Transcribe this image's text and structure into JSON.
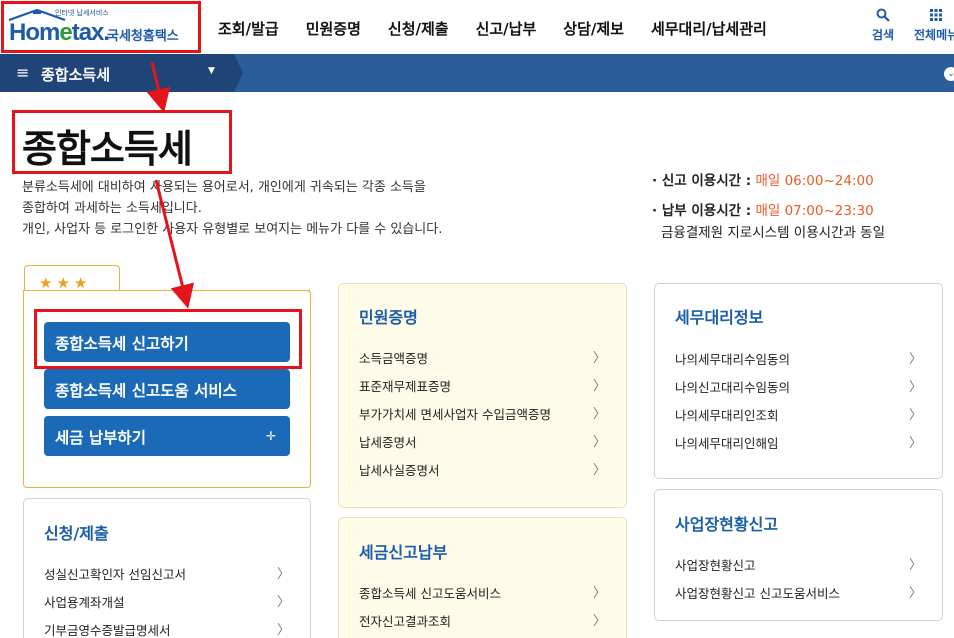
{
  "header": {
    "logo_small": "인터넷 납세서비스",
    "logo_brand_a": "Hom",
    "logo_brand_e": "e",
    "logo_brand_b": "tax.",
    "logo_sub": "국세청홈택스",
    "nav": [
      "조회/발급",
      "민원증명",
      "신청/제출",
      "신고/납부",
      "상담/제보",
      "세무대리/납세관리"
    ],
    "search_label": "검색",
    "allmenu_label": "전체메뉴"
  },
  "subbar": {
    "label": "종합소득세"
  },
  "page_title": "종합소득세",
  "description": [
    "분류소득세에 대비하여 사용되는 용어로서, 개인에게 귀속되는 각종 소득을",
    "종합하여 과세하는 소득세입니다.",
    "개인, 사업자 등 로그인한 사용자 유형별로 보여지는 메뉴가 다를 수 있습니다."
  ],
  "info": {
    "report_key": "· 신고 이용시간 :",
    "report_val": "매일 06:00~24:00",
    "pay_key": "· 납부 이용시간 :",
    "pay_val": "매일 07:00~23:30",
    "pay_note": "금융결제원 지로시스템 이용시간과 동일"
  },
  "quick": {
    "stars": "★★★",
    "buttons": [
      "종합소득세 신고하기",
      "종합소득세 신고도움 서비스",
      "세금 납부하기"
    ]
  },
  "cards": {
    "minwon": {
      "title": "민원증명",
      "items": [
        "소득금액증명",
        "표준재무제표증명",
        "부가가치세 면세사업자 수입금액증명",
        "납세증명서",
        "납세사실증명서"
      ]
    },
    "semu": {
      "title": "세무대리정보",
      "items": [
        "나의세무대리수임동의",
        "나의신고대리수임동의",
        "나의세무대리인조회",
        "나의세무대리인해임"
      ]
    },
    "apply": {
      "title": "신청/제출",
      "items": [
        "성실신고확인자 선임신고서",
        "사업용계좌개설",
        "기부금영수증발급명세서"
      ]
    },
    "taxreport": {
      "title": "세금신고납부",
      "items": [
        "종합소득세 신고도움서비스",
        "전자신고결과조회"
      ]
    },
    "bizstatus": {
      "title": "사업장현황신고",
      "items": [
        "사업장현황신고",
        "사업장현황신고 신고도움서비스"
      ]
    }
  },
  "colors": {
    "primary": "#1b6ab8",
    "annotation": "#e4141a",
    "accent_time": "#ee5a24",
    "star": "#f0a020"
  }
}
